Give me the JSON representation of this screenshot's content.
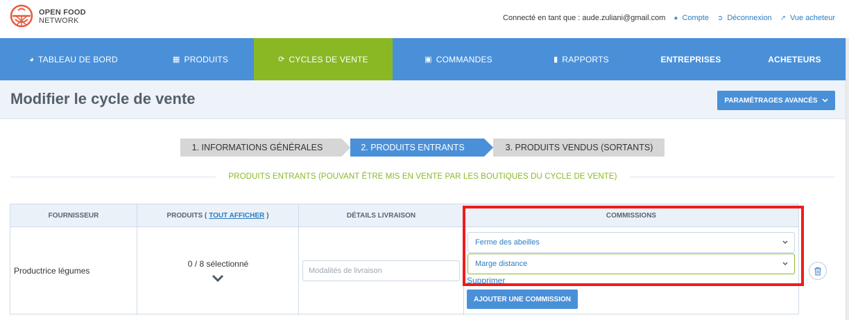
{
  "brand": {
    "line1": "OPEN FOOD",
    "line2": "NETWORK"
  },
  "user_bar": {
    "logged_in_as": "Connecté en tant que : aude.zuliani@gmail.com",
    "account": "Compte",
    "logout": "Déconnexion",
    "shopper_view": "Vue acheteur"
  },
  "nav": [
    {
      "label": "TABLEAU DE BORD",
      "icon": "dashboard-icon"
    },
    {
      "label": "PRODUITS",
      "icon": "grid-icon"
    },
    {
      "label": "CYCLES DE VENTE",
      "icon": "refresh-icon",
      "active": true
    },
    {
      "label": "COMMANDES",
      "icon": "cart-icon"
    },
    {
      "label": "RAPPORTS",
      "icon": "file-icon"
    },
    {
      "label": "ENTREPRISES"
    },
    {
      "label": "ACHETEURS"
    }
  ],
  "page": {
    "title": "Modifier le cycle de vente",
    "advanced_settings": "PARAMÉTRAGES AVANCÉS"
  },
  "wizard": {
    "steps": [
      "1. INFORMATIONS GÉNÉRALES",
      "2. PRODUITS ENTRANTS",
      "3. PRODUITS VENDUS (SORTANTS)"
    ],
    "active_step": 2
  },
  "section_title": "PRODUITS ENTRANTS (POUVANT ÊTRE MIS EN VENTE PAR LES BOUTIQUES DU CYCLE DE VENTE)",
  "table": {
    "headers": {
      "supplier": "FOURNISSEUR",
      "products_prefix": "PRODUITS (",
      "products_link": "TOUT AFFICHER",
      "products_suffix": ")",
      "delivery": "DÉTAILS LIVRAISON",
      "fees": "COMMISSIONS"
    },
    "row": {
      "supplier": "Productrice légumes",
      "products_selected": "0 / 8 sélectionné",
      "delivery_placeholder": "Modalités de livraison",
      "fee_enterprise": "Ferme des abeilles",
      "fee_type": "Marge distance",
      "remove": "Supprimer",
      "add_fee": "AJOUTER UNE COMMISSION"
    }
  },
  "colors": {
    "primary": "#4a90d9",
    "active_green": "#8ab825",
    "highlight": "#ee1c1c"
  }
}
